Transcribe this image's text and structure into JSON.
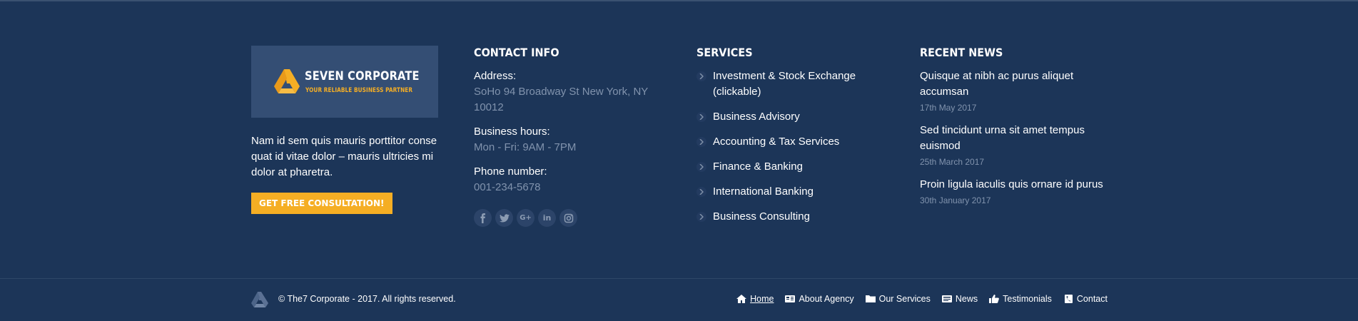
{
  "brand": {
    "name": "SEVEN CORPORATE",
    "tagline": "YOUR RELIABLE BUSINESS PARTNER",
    "accent_color": "#f5ae24",
    "background_color": "#1c3558"
  },
  "about": {
    "text": "Nam id sem quis mauris porttitor conse quat id vitae dolor – mauris ultricies mi dolor at pharetra.",
    "cta_label": "GET FREE CONSULTATION!"
  },
  "contact": {
    "title": "CONTACT INFO",
    "address_label": "Address:",
    "address_value": "SoHo 94 Broadway St New York, NY 10012",
    "hours_label": "Business hours:",
    "hours_value": "Mon - Fri: 9AM - 7PM",
    "phone_label": "Phone number:",
    "phone_value": "001-234-5678",
    "socials": [
      {
        "name": "facebook-icon",
        "glyph": "f"
      },
      {
        "name": "twitter-icon",
        "glyph": "t"
      },
      {
        "name": "google-plus-icon",
        "glyph": "G+"
      },
      {
        "name": "linkedin-icon",
        "glyph": "in"
      },
      {
        "name": "instagram-icon",
        "glyph": "ig"
      }
    ]
  },
  "services": {
    "title": "SERVICES",
    "items": [
      "Investment & Stock Exchange (clickable)",
      "Business Advisory",
      "Accounting & Tax Services",
      "Finance & Banking",
      "International Banking",
      "Business Consulting"
    ]
  },
  "news": {
    "title": "RECENT NEWS",
    "items": [
      {
        "title": "Quisque at nibh ac purus aliquet accumsan",
        "date": "17th May 2017"
      },
      {
        "title": "Sed tincidunt urna sit amet tempus euismod",
        "date": "25th March 2017"
      },
      {
        "title": "Proin ligula iaculis quis ornare id purus",
        "date": "30th January 2017"
      }
    ]
  },
  "bottom": {
    "copyright": "© The7 Corporate - 2017. All rights reserved.",
    "nav": [
      {
        "label": "Home",
        "icon": "home-icon",
        "active": true
      },
      {
        "label": "About Agency",
        "icon": "id-card-icon",
        "active": false
      },
      {
        "label": "Our Services",
        "icon": "folder-icon",
        "active": false
      },
      {
        "label": "News",
        "icon": "newspaper-icon",
        "active": false
      },
      {
        "label": "Testimonials",
        "icon": "thumbs-up-icon",
        "active": false
      },
      {
        "label": "Contact",
        "icon": "contact-icon",
        "active": false
      }
    ]
  }
}
